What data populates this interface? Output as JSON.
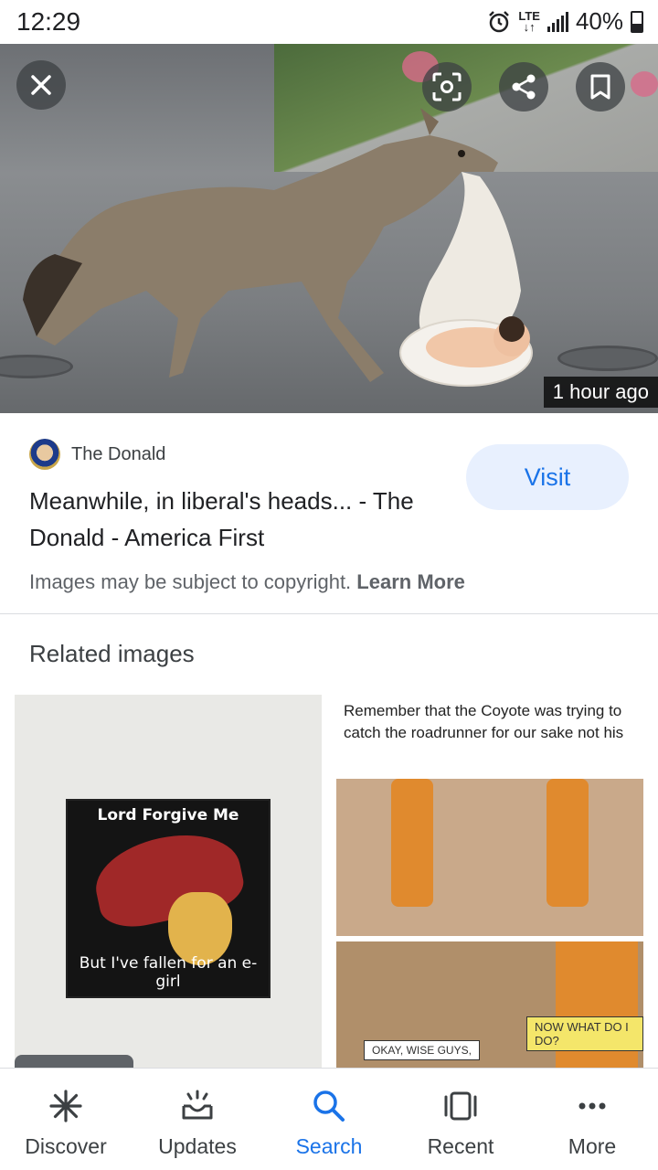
{
  "status_bar": {
    "time": "12:29",
    "network": "LTE",
    "battery": "40%"
  },
  "hero": {
    "timestamp": "1 hour ago",
    "close_icon": "close-icon",
    "lens_icon": "lens-icon",
    "share_icon": "share-icon",
    "bookmark_icon": "bookmark-icon"
  },
  "source": {
    "name": "The Donald",
    "title": "Meanwhile, in liberal's heads... - The Donald - America First",
    "visit_label": "Visit"
  },
  "copyright": {
    "text": "Images may be subject to copyright.",
    "learn_more": "Learn More"
  },
  "related": {
    "heading": "Related images",
    "items": [
      {
        "top_text": "Lord Forgive Me",
        "bottom_text": "But I've fallen for an e-girl"
      },
      {
        "caption": "Remember that the Coyote was trying to catch the roadrunner for our sake not his",
        "bubble_1": "NOW WHAT DO I DO?",
        "bubble_2": "OKAY, WISE GUYS,"
      }
    ]
  },
  "bottom_nav": {
    "items": [
      {
        "label": "Discover",
        "icon": "asterisk-icon"
      },
      {
        "label": "Updates",
        "icon": "updates-icon"
      },
      {
        "label": "Search",
        "icon": "search-icon"
      },
      {
        "label": "Recent",
        "icon": "recent-icon"
      },
      {
        "label": "More",
        "icon": "more-icon"
      }
    ],
    "active": "Search"
  },
  "colors": {
    "accent": "#1a73e8",
    "visit_bg": "#e8f0fe"
  }
}
